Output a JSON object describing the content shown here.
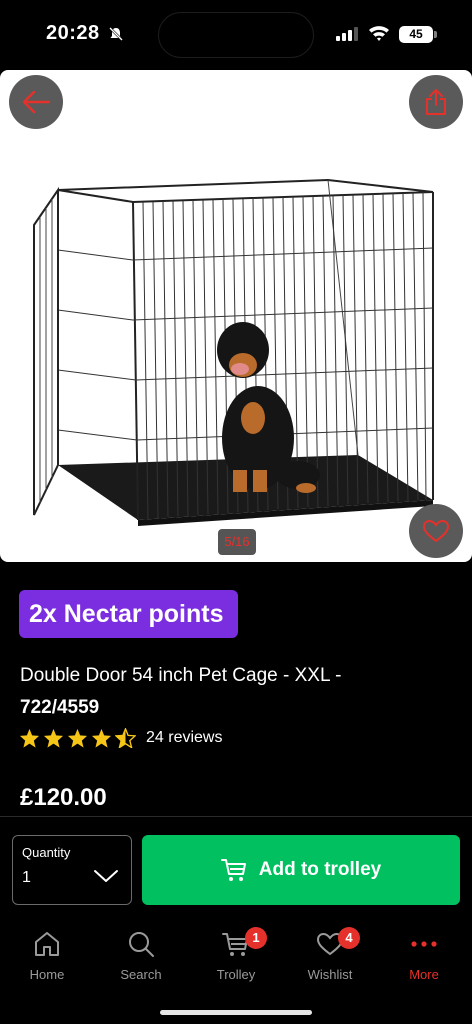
{
  "status_bar": {
    "time": "20:28",
    "battery": "45"
  },
  "gallery": {
    "counter": "5/16"
  },
  "promo": {
    "nectar_label": "2x Nectar points"
  },
  "product": {
    "title": "Double Door 54 inch Pet Cage - XXL -",
    "code": "722/4559",
    "rating": 4.5,
    "reviews": "24 reviews",
    "price": "£120.00"
  },
  "purchase": {
    "quantity_label": "Quantity",
    "quantity_value": "1",
    "add_button_label": "Add to trolley"
  },
  "tabs": [
    {
      "label": "Home",
      "icon": "home-icon"
    },
    {
      "label": "Search",
      "icon": "search-icon"
    },
    {
      "label": "Trolley",
      "icon": "trolley-icon",
      "badge": "1"
    },
    {
      "label": "Wishlist",
      "icon": "heart-icon",
      "badge": "4"
    },
    {
      "label": "More",
      "icon": "more-icon",
      "active": true
    }
  ],
  "colors": {
    "accent_red": "#e5312b",
    "nectar_purple": "#7b2de0",
    "cta_green": "#00c05f"
  }
}
